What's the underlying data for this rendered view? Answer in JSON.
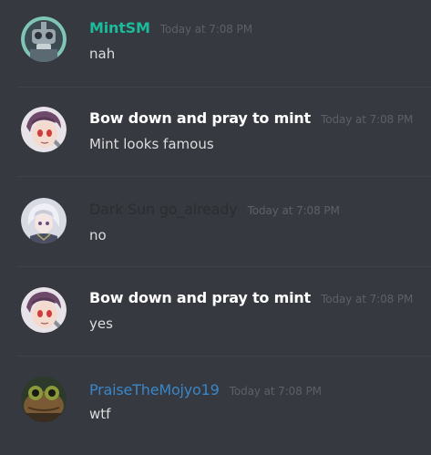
{
  "messages": [
    {
      "username": "MintSM",
      "timestamp": "Today at 7:08 PM",
      "text": "nah",
      "name_color": "#1abc9c",
      "avatar_icon": "robot-avatar-icon"
    },
    {
      "username": "Bow down and pray to mint",
      "timestamp": "Today at 7:08 PM",
      "text": "Mint looks famous",
      "name_color": "#ffffff",
      "avatar_icon": "anime-girl-avatar-icon"
    },
    {
      "username": "Dark Sun go_already",
      "timestamp": "Today at 7:08 PM",
      "text": "no",
      "name_color": "#2b2d31",
      "avatar_icon": "silver-hair-avatar-icon"
    },
    {
      "username": "Bow down and pray to mint",
      "timestamp": "Today at 7:08 PM",
      "text": "yes",
      "name_color": "#ffffff",
      "avatar_icon": "anime-girl-avatar-icon"
    },
    {
      "username": "PraiseTheMojyo19",
      "timestamp": "Today at 7:08 PM",
      "text": "wtf",
      "name_color": "#3a86c8",
      "avatar_icon": "frog-avatar-icon"
    }
  ]
}
